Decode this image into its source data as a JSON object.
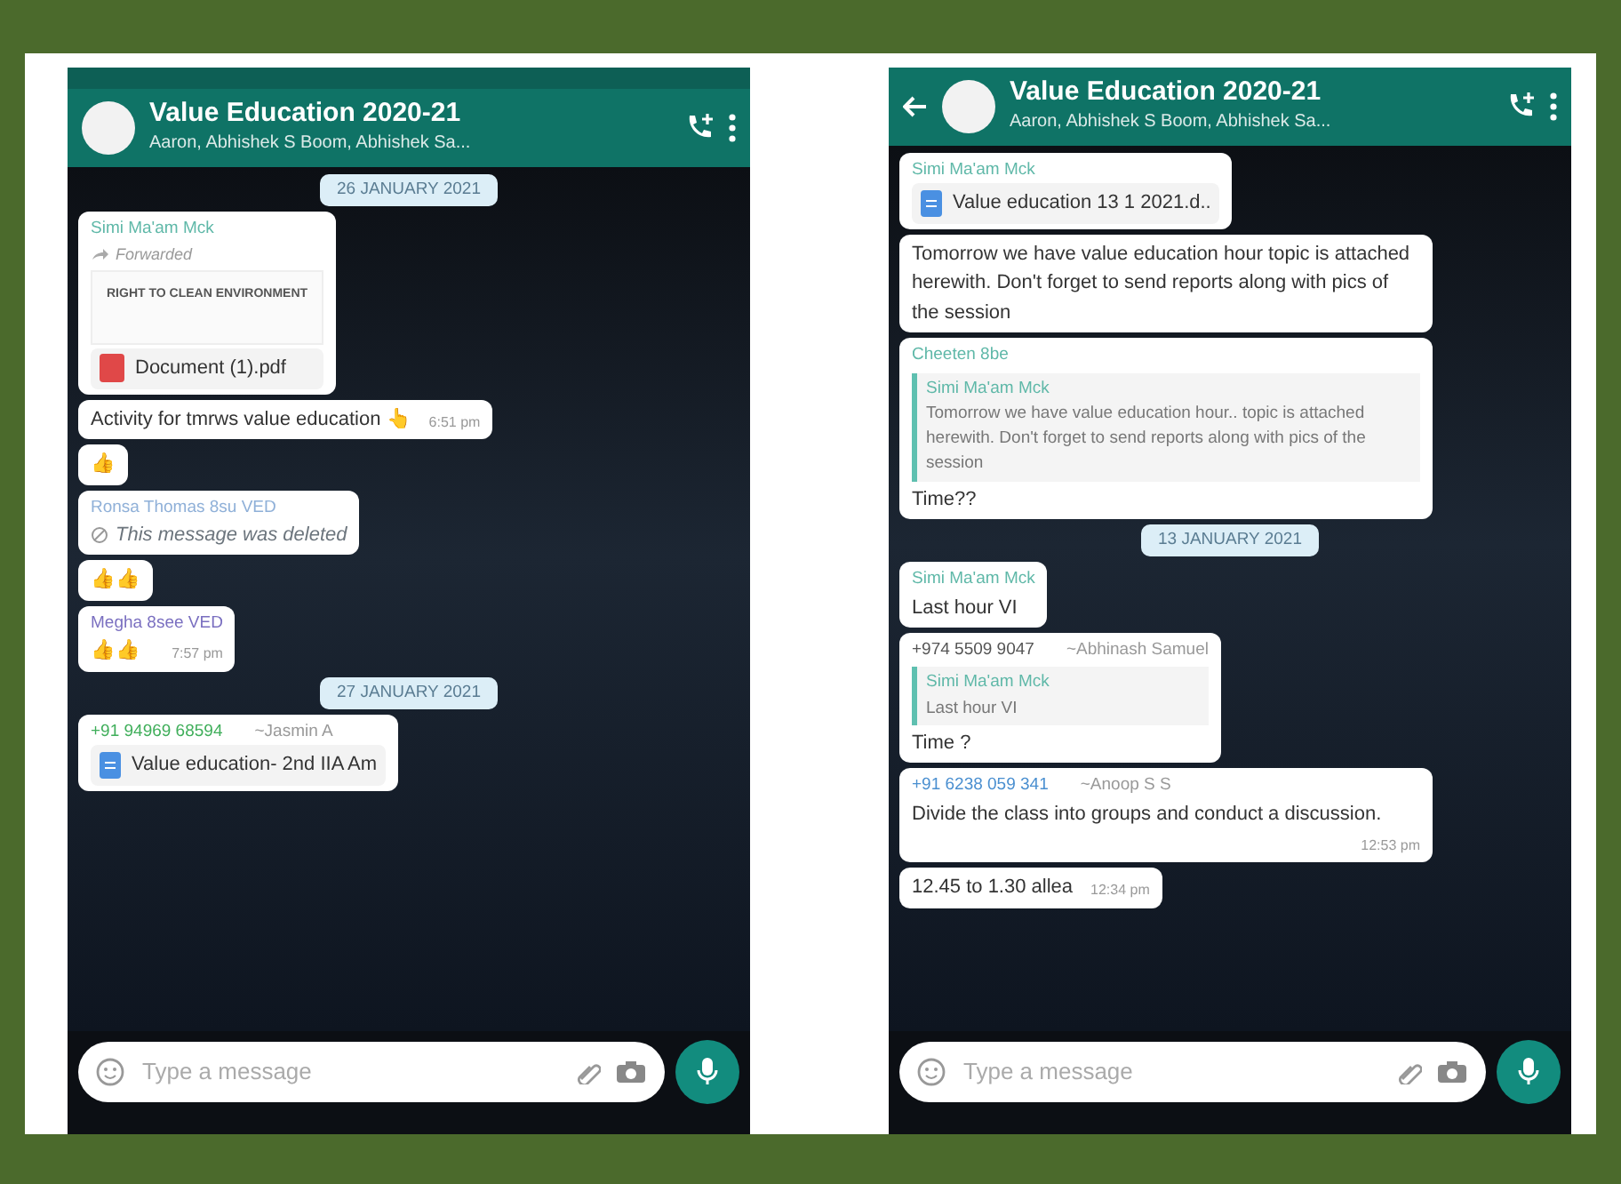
{
  "phones": [
    {
      "status_bar": true,
      "back_button": false,
      "header": {
        "title": "Value Education 2020-21",
        "subtitle": "Aaron, Abhishek S Boom, Abhishek Sa..."
      },
      "messages": [
        {
          "kind": "date",
          "text": "26 JANUARY 2021"
        },
        {
          "kind": "document",
          "sender": "Simi Ma'am Mck",
          "color": "#5fb8a8",
          "forwarded": true,
          "forward_label": "Forwarded",
          "preview_title": "RIGHT TO CLEAN ENVIRONMENT",
          "file": {
            "kind": "pdf",
            "name": "Document (1).pdf"
          }
        },
        {
          "kind": "text",
          "text": "Activity for tmrws value education 👆",
          "time": "6:51 pm"
        },
        {
          "kind": "text",
          "text": "👍"
        },
        {
          "kind": "deleted",
          "sender": "Ronsa Thomas 8su VED",
          "color": "#8fb0d8",
          "text": "This message was deleted"
        },
        {
          "kind": "text",
          "text": "👍👍"
        },
        {
          "kind": "text",
          "sender": "Megha 8see VED",
          "color": "#7a6fc0",
          "text": "👍👍",
          "time": "7:57 pm"
        },
        {
          "kind": "date",
          "text": "27 JANUARY 2021"
        },
        {
          "kind": "document",
          "sender": "+91 94969 68594",
          "color": "#3fae5a",
          "alias": "~Jasmin A",
          "forwarded": false,
          "file": {
            "kind": "doc",
            "name": "Value education- 2nd IIA Am"
          }
        }
      ],
      "input": {
        "placeholder": "Type a message"
      }
    },
    {
      "status_bar": false,
      "back_button": true,
      "header": {
        "title": "Value Education 2020-21",
        "subtitle": "Aaron, Abhishek S Boom, Abhishek Sa..."
      },
      "messages": [
        {
          "kind": "document",
          "sender": "Simi Ma'am Mck",
          "color": "#5fb8a8",
          "forwarded": false,
          "file": {
            "kind": "doc",
            "name": "Value education 13 1 2021.d.."
          }
        },
        {
          "kind": "text",
          "text": "Tomorrow we have value education hour topic is attached herewith. Don't forget to send reports along with pics of the session"
        },
        {
          "kind": "quote",
          "sender": "Cheeten 8be",
          "color": "#5fb8a8",
          "quote": {
            "author": "Simi Ma'am Mck",
            "text": "Tomorrow we have value education hour.. topic is attached herewith. Don't forget to send reports along with pics of the session"
          },
          "text": "Time??"
        },
        {
          "kind": "date",
          "text": "13 JANUARY 2021"
        },
        {
          "kind": "text",
          "sender": "Simi Ma'am Mck",
          "color": "#5fb8a8",
          "text": "Last hour VI"
        },
        {
          "kind": "quote",
          "sender": "+974 5509 9047",
          "color": "#555555",
          "alias": "~Abhinash Samuel",
          "quote": {
            "author": "Simi Ma'am Mck",
            "text": "Last hour VI"
          },
          "text": "Time ?"
        },
        {
          "kind": "text",
          "sender": "+91 6238 059 341",
          "color": "#4a8fd0",
          "alias": "~Anoop S S",
          "text": "Divide the class into groups and conduct a discussion.",
          "time": "12:53 pm"
        },
        {
          "kind": "text",
          "text": "12.45 to 1.30 allea",
          "time": "12:34 pm"
        }
      ],
      "input": {
        "placeholder": "Type a message"
      }
    }
  ]
}
